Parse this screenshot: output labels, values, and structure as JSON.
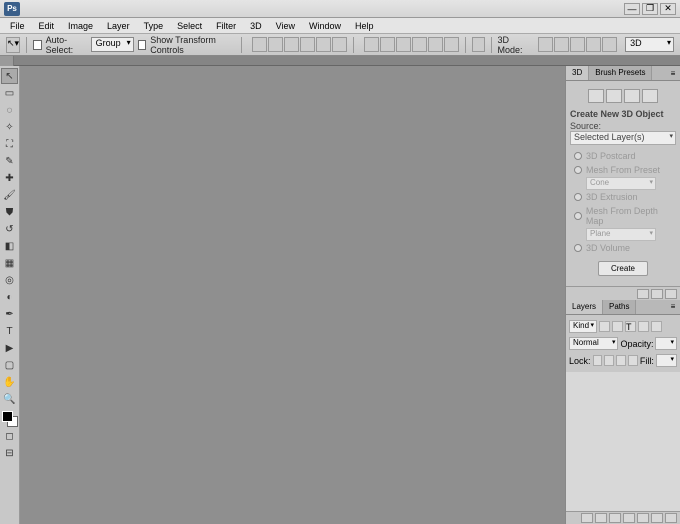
{
  "app": {
    "short": "Ps"
  },
  "menu": [
    "File",
    "Edit",
    "Image",
    "Layer",
    "Type",
    "Select",
    "Filter",
    "3D",
    "View",
    "Window",
    "Help"
  ],
  "options": {
    "auto_select": "Auto-Select:",
    "group": "Group",
    "show_transform": "Show Transform Controls",
    "mode_label": "3D Mode:",
    "workspace": "3D"
  },
  "panel3d": {
    "tabs": [
      "3D",
      "Brush Presets"
    ],
    "section_title": "Create New 3D Object",
    "source_label": "Source:",
    "source_select": "Selected Layer(s)",
    "opts": {
      "postcard": "3D Postcard",
      "mesh_preset": "Mesh From Preset",
      "mesh_preset_val": "Cone",
      "extrusion": "3D Extrusion",
      "depth": "Mesh From Depth Map",
      "depth_val": "Plane",
      "volume": "3D Volume"
    },
    "create": "Create"
  },
  "layers": {
    "tabs": [
      "Layers",
      "Paths"
    ],
    "kind": "Kind",
    "blend": "Normal",
    "opacity_label": "Opacity:",
    "lock_label": "Lock:",
    "fill_label": "Fill:"
  }
}
